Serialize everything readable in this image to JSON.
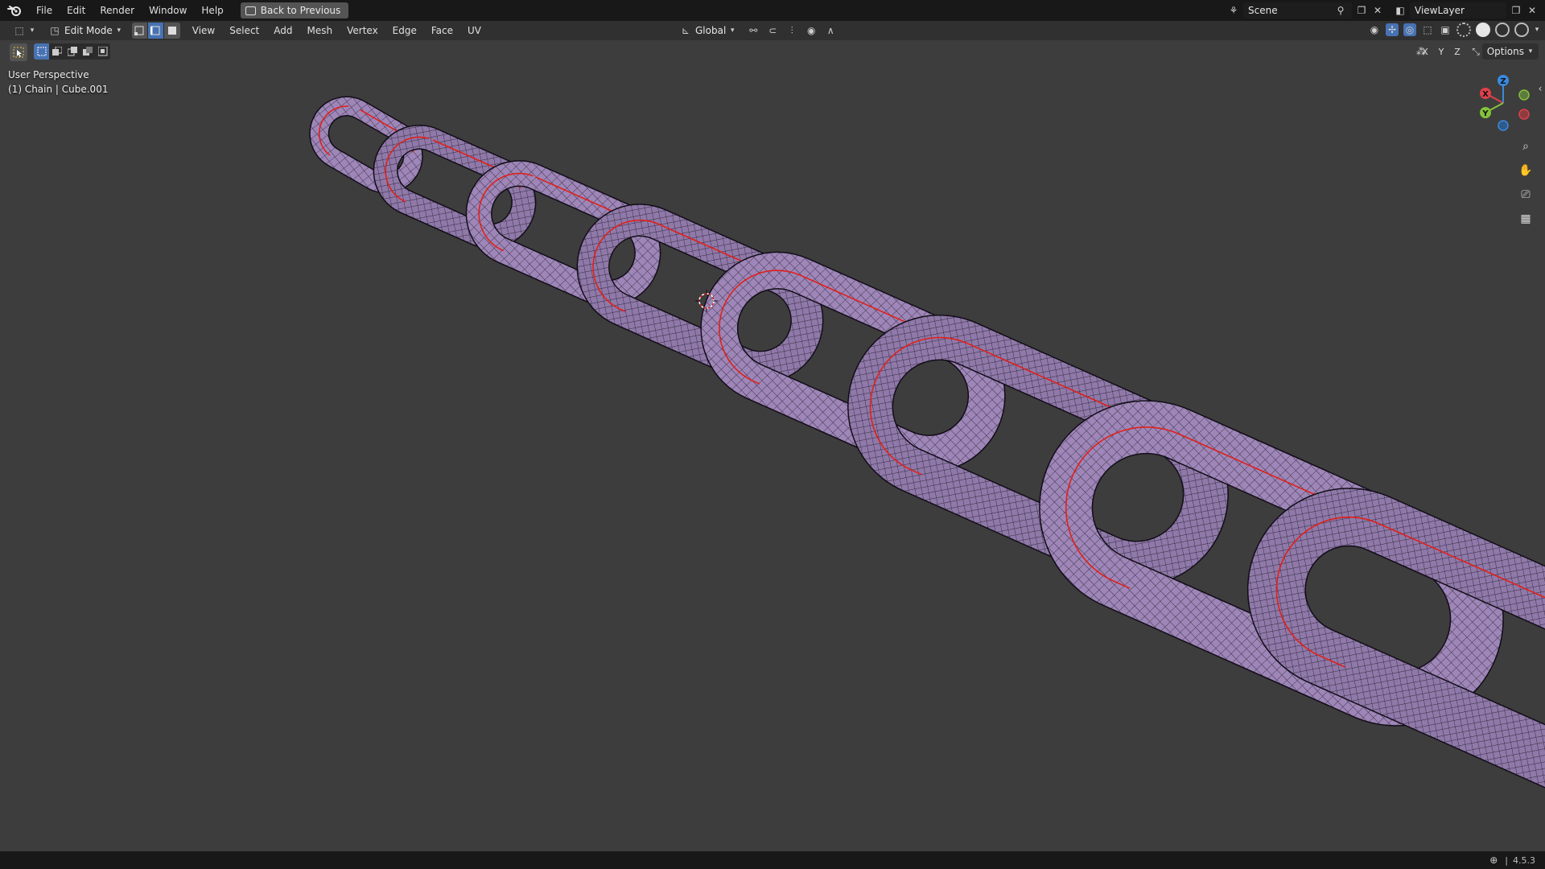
{
  "menu": {
    "items": [
      "File",
      "Edit",
      "Render",
      "Window",
      "Help"
    ],
    "back_button": "Back to Previous"
  },
  "top_right": {
    "scene": "Scene",
    "view_layer": "ViewLayer"
  },
  "header": {
    "mode": "Edit Mode",
    "menus": [
      "View",
      "Select",
      "Add",
      "Mesh",
      "Vertex",
      "Edge",
      "Face",
      "UV"
    ],
    "transform_orientation": "Global",
    "select_mode_active": "edge"
  },
  "toolrow": {
    "axes": [
      "X",
      "Y",
      "Z"
    ],
    "options_label": "Options"
  },
  "viewport": {
    "perspective": "User Perspective",
    "object_info": "(1) Chain | Cube.001",
    "mesh_color": "#9e86b8",
    "wire_color": "#1a1320",
    "seam_color": "#e0201a",
    "background": "#3d3d3d"
  },
  "gizmo": {
    "axis_labels": [
      "X",
      "Y",
      "Z"
    ],
    "colors": {
      "x": "#e0404a",
      "y": "#82c33a",
      "z": "#3a8ae0"
    }
  },
  "status": {
    "version": "4.5.3"
  }
}
